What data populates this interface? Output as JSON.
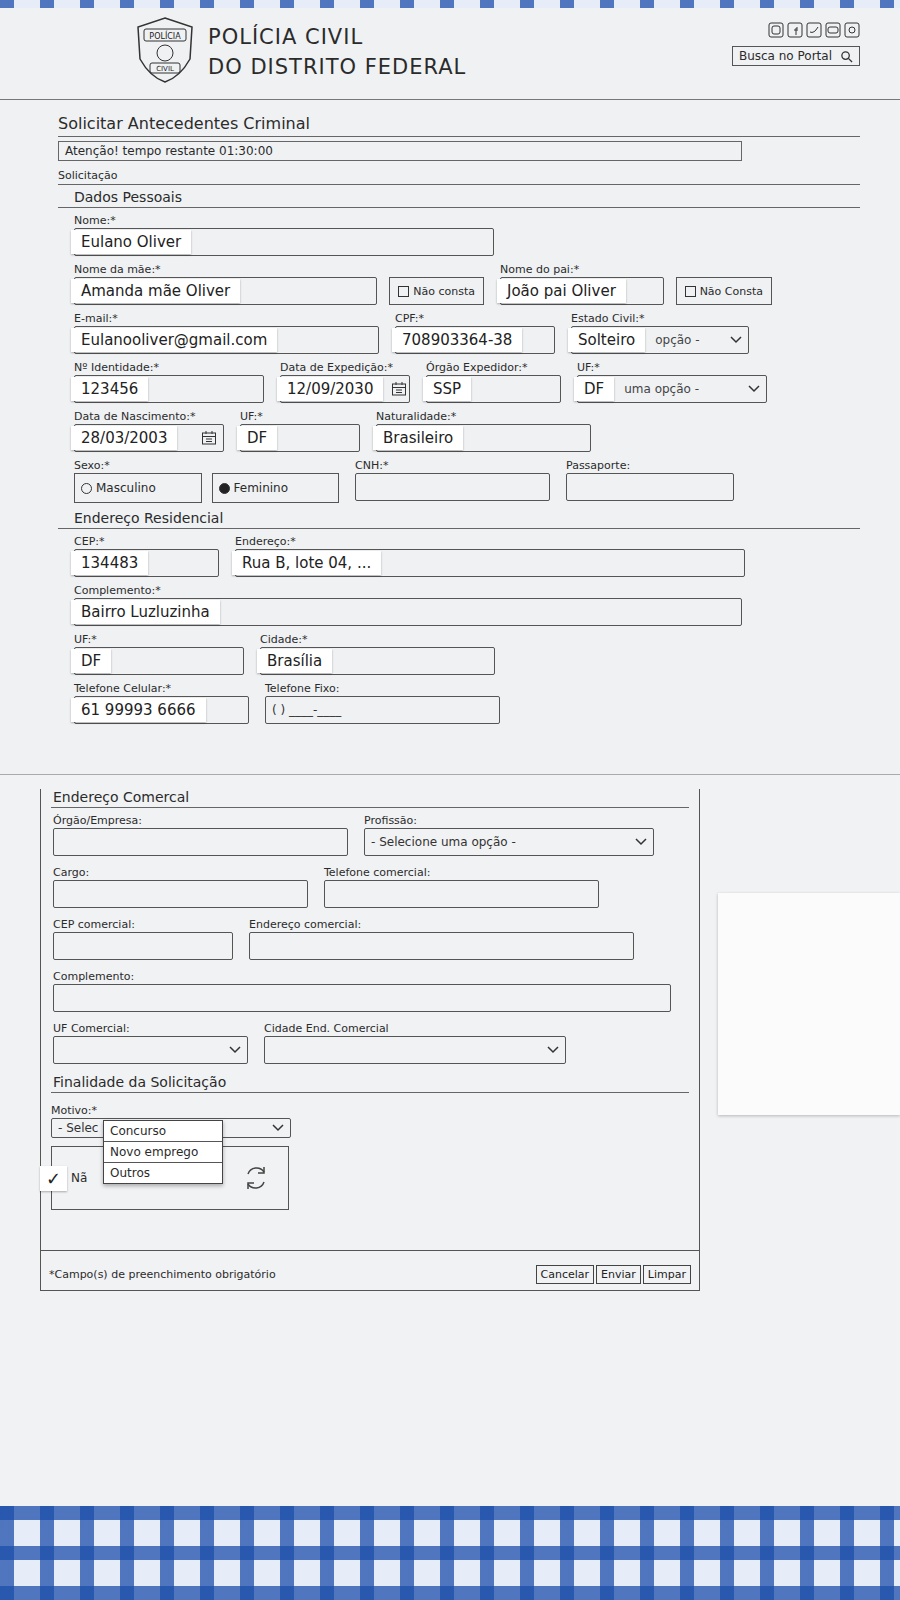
{
  "header": {
    "brand_line1": "POLÍCIA CIVIL",
    "brand_line2": "DO DISTRITO FEDERAL",
    "logo_top": "POLÍCIA",
    "logo_bottom": "CIVIL",
    "search": {
      "placeholder": "Busca no Portal"
    }
  },
  "form": {
    "title": "Solicitar Antecedentes Criminal",
    "notice": "Atenção! tempo restante 01:30:00",
    "section": "Solicitação",
    "personal": {
      "title": "Dados Pessoais",
      "rows": [
        [
          {
            "label": "Nome:*",
            "value": "Eulano Oliver",
            "kind": "text"
          }
        ],
        [
          {
            "label": "Nome da mãe:*",
            "value": "Amanda mãe Oliver",
            "kind": "text",
            "checkbox": {
              "label": "Não consta",
              "checked": false
            }
          },
          {
            "label": "Nome do pai:*",
            "value": "João pai Oliver",
            "kind": "text",
            "checkbox": {
              "label": "Não Consta",
              "checked": false
            }
          }
        ],
        [
          {
            "label": "E-mail:*",
            "value": "Eulanooliver@gmail.com",
            "kind": "text"
          },
          {
            "label": "CPF:*",
            "value": "708903364-38",
            "kind": "text"
          },
          {
            "label": "Estado Civil:*",
            "value": "Solteiro",
            "kind": "select",
            "placeholder_tail": "opção -"
          }
        ],
        [
          {
            "label": "Nº Identidade:*",
            "value": "123456",
            "kind": "text"
          },
          {
            "label": "Data de Expedição:*",
            "value": "12/09/2030",
            "kind": "date"
          },
          {
            "label": "Órgão Expedidor:*",
            "value": "SSP",
            "kind": "text"
          },
          {
            "label": "UF:*",
            "value": "DF",
            "kind": "select",
            "placeholder_tail": "uma opção -"
          }
        ],
        [
          {
            "label": "Data de Nascimento:*",
            "value": "28/03/2003",
            "kind": "date"
          },
          {
            "label": "UF:*",
            "value": "DF",
            "kind": "text"
          },
          {
            "label": "Naturalidade:*",
            "value": "Brasileiro",
            "kind": "text"
          }
        ],
        [
          {
            "label": "Sexo:*",
            "kind": "radio",
            "options": [
              {
                "label": "Masculino",
                "selected": false
              },
              {
                "label": "Feminino",
                "selected": true
              }
            ]
          },
          {
            "label": "CNH:*",
            "value": "",
            "kind": "text"
          },
          {
            "label": "Passaporte:",
            "value": "",
            "kind": "text"
          }
        ]
      ]
    },
    "residential": {
      "title": "Endereço Residencial",
      "rows": [
        [
          {
            "label": "CEP:*",
            "value": "134483",
            "kind": "text"
          },
          {
            "label": "Endereço:*",
            "value": "Rua B, lote 04, ...",
            "kind": "text"
          }
        ],
        [
          {
            "label": "Complemento:*",
            "value": "Bairro Luzluzinha",
            "kind": "text"
          }
        ],
        [
          {
            "label": "UF:*",
            "value": "DF",
            "kind": "text"
          },
          {
            "label": "Cidade:*",
            "value": "Brasília",
            "kind": "text"
          }
        ],
        [
          {
            "label": "Telefone Celular:*",
            "value": "61 99993 6666",
            "kind": "text"
          },
          {
            "label": "Telefone Fixo:",
            "value": "",
            "placeholder": "( ) ____-____",
            "kind": "text"
          }
        ]
      ]
    },
    "commercial": {
      "title": "Endereço Comercal",
      "rows": [
        [
          {
            "label": "Órgão/Empresa:",
            "value": "",
            "kind": "text"
          },
          {
            "label": "Profissão:",
            "value": "",
            "placeholder": "- Selecione uma opção -",
            "kind": "select"
          }
        ],
        [
          {
            "label": "Cargo:",
            "value": "",
            "kind": "text"
          },
          {
            "label": "Telefone comercial:",
            "value": "",
            "kind": "text"
          }
        ],
        [
          {
            "label": "CEP comercial:",
            "value": "",
            "kind": "text"
          },
          {
            "label": "Endereço comercial:",
            "value": "",
            "kind": "text"
          }
        ],
        [
          {
            "label": "Complemento:",
            "value": "",
            "kind": "text"
          }
        ],
        [
          {
            "label": "UF Comercial:",
            "value": "",
            "kind": "select"
          },
          {
            "label": "Cidade End. Comercial",
            "value": "",
            "kind": "select"
          }
        ]
      ]
    },
    "purpose": {
      "title": "Finalidade da Solicitação",
      "motivo_label": "Motivo:*",
      "motivo_placeholder": "- Selec",
      "options": [
        {
          "label": "Concurso",
          "selected": false
        },
        {
          "label": "Novo emprego",
          "selected": false
        },
        {
          "label": "Outros",
          "selected": false
        }
      ],
      "captcha": {
        "check": "✓",
        "label": "Nã",
        "checked": true
      }
    },
    "footer": {
      "note": "*Campo(s) de preenchimento obrigatório",
      "buttons": [
        "Cancelar",
        "Enviar",
        "Limpar"
      ]
    }
  }
}
